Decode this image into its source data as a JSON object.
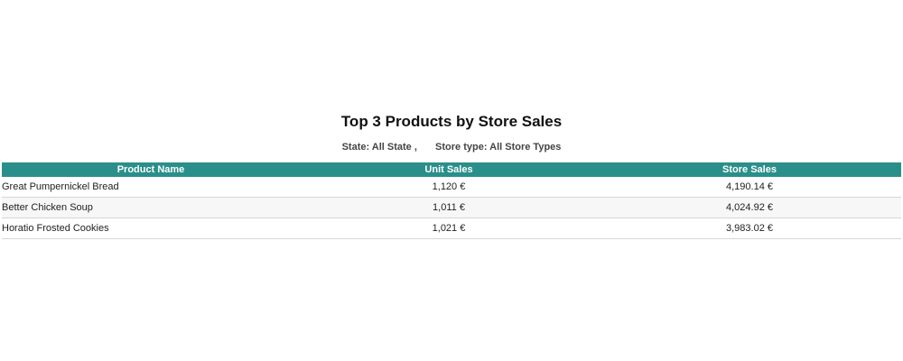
{
  "report": {
    "title": "Top 3 Products by Store Sales",
    "filters": {
      "state": "State: All State ,",
      "store_type": "Store type: All Store Types"
    }
  },
  "table": {
    "columns": [
      "Product Name",
      "Unit Sales",
      "Store Sales"
    ],
    "rows": [
      {
        "product": "Great Pumpernickel Bread",
        "unit_sales": "1,120 €",
        "store_sales": "4,190.14 €"
      },
      {
        "product": "Better Chicken Soup",
        "unit_sales": "1,011 €",
        "store_sales": "4,024.92 €"
      },
      {
        "product": "Horatio Frosted Cookies",
        "unit_sales": "1,021 €",
        "store_sales": "3,983.02 €"
      }
    ]
  },
  "colors": {
    "header_background": "#2a8f8a",
    "header_text": "#ffffff",
    "row_alt_background": "#f7f7f7"
  }
}
